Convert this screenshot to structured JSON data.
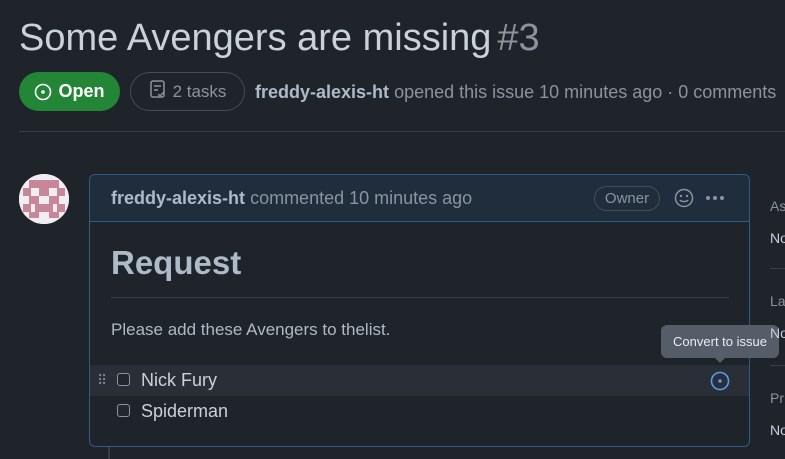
{
  "issue": {
    "title": "Some Avengers are missing",
    "number": "#3",
    "state": "Open",
    "tasks": "2 tasks",
    "author": "freddy-alexis-ht",
    "opened_text": "opened this issue 10 minutes ago · 0 comments"
  },
  "comment": {
    "author": "freddy-alexis-ht",
    "action": "commented 10 minutes ago",
    "role_badge": "Owner",
    "heading": "Request",
    "body": "Please add these Avengers to thelist.",
    "tasks": [
      {
        "label": "Nick Fury",
        "checked": false,
        "hovered": true
      },
      {
        "label": "Spiderman",
        "checked": false,
        "hovered": false
      }
    ],
    "tooltip": "Convert to issue"
  },
  "sidebar": {
    "items": [
      {
        "label": "As",
        "value": "No"
      },
      {
        "label": "La",
        "value": "No"
      },
      {
        "label": "Pr",
        "value": "No"
      }
    ]
  },
  "colors": {
    "open_green": "#238636",
    "accent_blue": "#539bf5",
    "background": "#1f232a"
  },
  "icons": [
    "issue-opened-icon",
    "checklist-icon",
    "smiley-icon",
    "kebab-icon",
    "drag-handle-icon",
    "convert-to-issue-icon"
  ]
}
